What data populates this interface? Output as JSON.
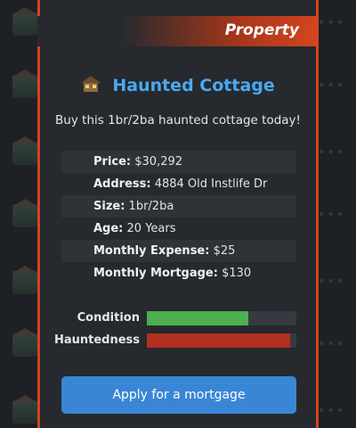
{
  "header": {
    "title": "Property"
  },
  "property": {
    "name": "Haunted Cottage",
    "description": "Buy this 1br/2ba haunted cottage today!",
    "details": [
      {
        "key": "Price:",
        "value": "$30,292"
      },
      {
        "key": "Address:",
        "value": "4884 Old Instlife Dr"
      },
      {
        "key": "Size:",
        "value": "1br/2ba"
      },
      {
        "key": "Age:",
        "value": "20 Years"
      },
      {
        "key": "Monthly Expense:",
        "value": "$25"
      },
      {
        "key": "Monthly Mortgage:",
        "value": "$130"
      }
    ]
  },
  "meters": [
    {
      "label": "Condition",
      "percent": 68,
      "color": "#4caf50"
    },
    {
      "label": "Hauntedness",
      "percent": 96,
      "color": "#b2301f"
    }
  ],
  "action": {
    "label": "Apply for a mortgage"
  },
  "colors": {
    "accent": "#d4431f",
    "title": "#4ba8f2",
    "button": "#3a86d6"
  }
}
